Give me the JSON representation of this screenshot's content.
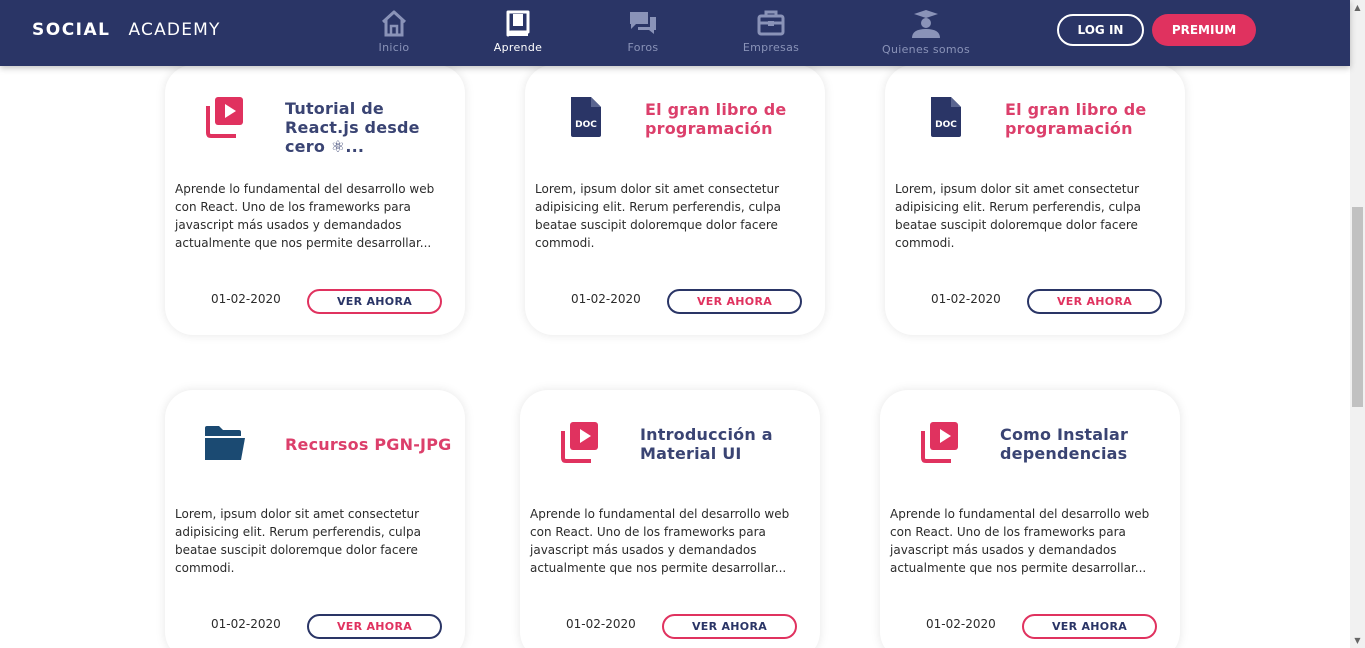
{
  "brand": {
    "part1": "SOCIAL",
    "part2": "ACADEMY"
  },
  "nav": [
    {
      "label": "Inicio",
      "icon": "home-icon",
      "active": false
    },
    {
      "label": "Aprende",
      "icon": "book-icon",
      "active": true
    },
    {
      "label": "Foros",
      "icon": "chat-icon",
      "active": false
    },
    {
      "label": "Empresas",
      "icon": "briefcase-icon",
      "active": false
    },
    {
      "label": "Quienes somos",
      "icon": "graduate-icon",
      "active": false
    }
  ],
  "auth": {
    "login": "LOG IN",
    "premium": "PREMIUM"
  },
  "colors": {
    "navy": "#2a3566",
    "pink": "#e0325f",
    "title_navy": "#3a4473",
    "title_pink": "#dc3f6b",
    "folder": "#1b4a72"
  },
  "cards": [
    {
      "icon": "video-icon",
      "title": "Tutorial de React.js desde cero ⚛...",
      "title_color": "navy",
      "description": "Aprende lo fundamental del desarrollo web con React. Uno de los frameworks para javascript más usados y demandados actualmente que nos permite desarrollar...",
      "date": "01-02-2020",
      "button": "VER AHORA",
      "button_border": "pink",
      "button_text": "navy"
    },
    {
      "icon": "doc-icon",
      "icon_text": "DOC",
      "title": "El gran libro de programación",
      "title_color": "pink",
      "description": "Lorem, ipsum dolor sit amet consectetur adipisicing elit. Rerum perferendis, culpa beatae suscipit doloremque dolor facere commodi.",
      "date": "01-02-2020",
      "button": "VER AHORA",
      "button_border": "navy",
      "button_text": "pink"
    },
    {
      "icon": "doc-icon",
      "icon_text": "DOC",
      "title": "El gran libro de programación",
      "title_color": "pink",
      "description": "Lorem, ipsum dolor sit amet consectetur adipisicing elit. Rerum perferendis, culpa beatae suscipit doloremque dolor facere commodi.",
      "date": "01-02-2020",
      "button": "VER AHORA",
      "button_border": "navy",
      "button_text": "pink"
    },
    {
      "icon": "folder-icon",
      "title": "Recursos PGN-JPG",
      "title_color": "pink",
      "description": "Lorem, ipsum dolor sit amet consectetur adipisicing elit. Rerum perferendis, culpa beatae suscipit doloremque dolor facere commodi.",
      "date": "01-02-2020",
      "button": "VER AHORA",
      "button_border": "navy",
      "button_text": "pink"
    },
    {
      "icon": "video-icon",
      "title": "Introducción a Material UI",
      "title_color": "navy",
      "description": "Aprende lo fundamental del desarrollo web con React. Uno de los frameworks para javascript más usados y demandados actualmente que nos permite desarrollar...",
      "date": "01-02-2020",
      "button": "VER AHORA",
      "button_border": "pink",
      "button_text": "navy"
    },
    {
      "icon": "video-icon",
      "title": "Como Instalar dependencias",
      "title_color": "navy",
      "description": "Aprende lo fundamental del desarrollo web con React. Uno de los frameworks para javascript más usados y demandados actualmente que nos permite desarrollar...",
      "date": "01-02-2020",
      "button": "VER AHORA",
      "button_border": "pink",
      "button_text": "navy"
    }
  ]
}
